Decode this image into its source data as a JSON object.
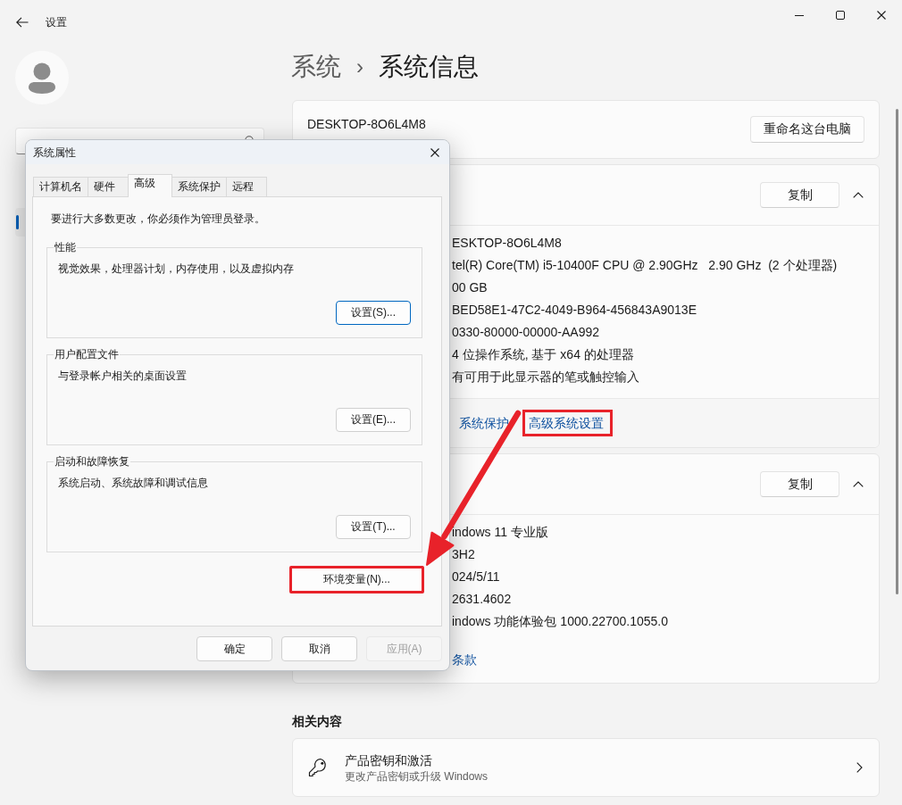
{
  "window": {
    "title": "设置"
  },
  "sidebar": {
    "items": [
      {
        "selected": true
      }
    ]
  },
  "breadcrumb": {
    "parent": "系统",
    "separator": "›",
    "current": "系统信息"
  },
  "device": {
    "name": "DESKTOP-8O6L4M8",
    "button": "重命名这台电脑"
  },
  "sections": [
    {
      "button": "复制",
      "expanded": true,
      "rows": [
        "ESKTOP-8O6L4M8",
        "tel(R) Core(TM) i5-10400F CPU @ 2.90GHz   2.90 GHz  (2 个处理器)",
        "00 GB",
        "BED58E1-47C2-4049-B964-456843A9013E",
        "0330-80000-00000-AA992",
        "4 位操作系统, 基于 x64 的处理器",
        "有可用于此显示器的笔或触控输入"
      ],
      "footer_links": [
        {
          "label": "系统保护",
          "highlighted": false
        },
        {
          "label": "高级系统设置",
          "highlighted": true
        }
      ]
    },
    {
      "button": "复制",
      "expanded": true,
      "rows": [
        "indows 11 专业版",
        "3H2",
        "024/5/11",
        "2631.4602",
        "indows 功能体验包 1000.22700.1055.0"
      ],
      "links": [
        {
          "label": "条款",
          "highlighted": false
        }
      ]
    }
  ],
  "related": {
    "title": "相关内容",
    "items": [
      {
        "title": "产品密钥和激活",
        "subtitle": "更改产品密钥或升级 Windows"
      }
    ]
  },
  "dialog": {
    "title": "系统属性",
    "tabs": [
      {
        "label": "计算机名",
        "selected": false
      },
      {
        "label": "硬件",
        "selected": false
      },
      {
        "label": "高级",
        "selected": true
      },
      {
        "label": "系统保护",
        "selected": false
      },
      {
        "label": "远程",
        "selected": false
      }
    ],
    "notice": "要进行大多数更改，你必须作为管理员登录。",
    "groups": [
      {
        "title": "性能",
        "description": "视觉效果，处理器计划，内存使用，以及虚拟内存",
        "button": {
          "label": "设置(S)...",
          "default": true
        }
      },
      {
        "title": "用户配置文件",
        "description": "与登录帐户相关的桌面设置",
        "button": {
          "label": "设置(E)...",
          "default": false
        }
      },
      {
        "title": "启动和故障恢复",
        "description": "系统启动、系统故障和调试信息",
        "button": {
          "label": "设置(T)...",
          "default": false
        }
      }
    ],
    "env_button": {
      "label": "环境变量(N)...",
      "highlighted": true
    },
    "buttons": [
      {
        "label": "确定",
        "disabled": false
      },
      {
        "label": "取消",
        "disabled": false
      },
      {
        "label": "应用(A)",
        "disabled": true
      }
    ]
  }
}
